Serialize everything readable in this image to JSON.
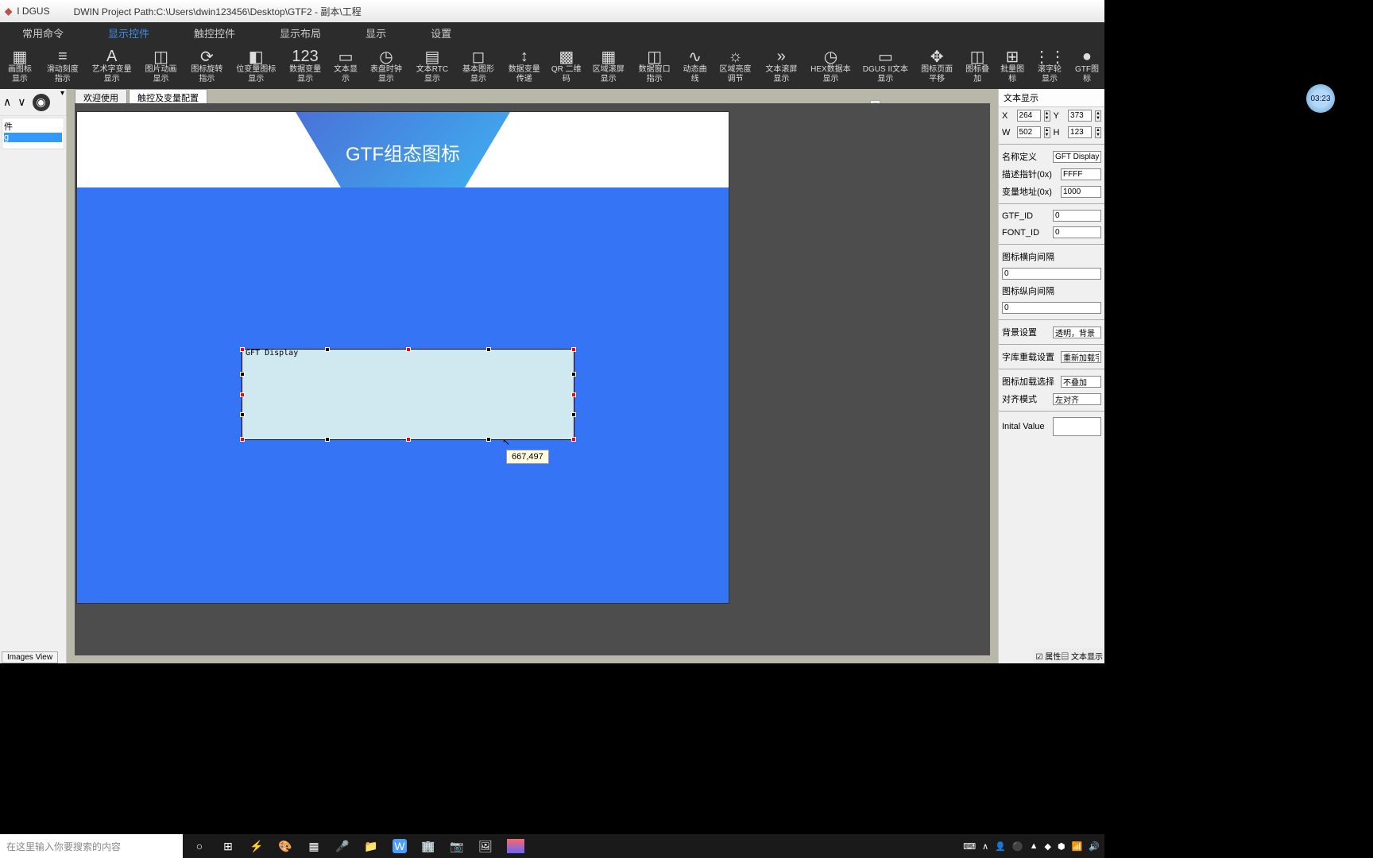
{
  "title_bar": {
    "app": "I DGUS",
    "path_label": "DWIN Project Path:C:\\Users\\dwin123456\\Desktop\\GTF2 - 副本\\工程"
  },
  "menu": {
    "items": [
      "常用命令",
      "显示控件",
      "触控控件",
      "显示布局",
      "显示",
      "设置"
    ],
    "active_index": 1
  },
  "toolbar": {
    "items": [
      "画图标显示",
      "滑动刻度指示",
      "艺术字变量显示",
      "图片动画显示",
      "图标旋转指示",
      "位变量图标显示",
      "数据变量显示",
      "文本显示",
      "表盘时钟显示",
      "文本RTC显示",
      "基本图形显示",
      "数据变量传递",
      "QR 二维码",
      "区域滚屏显示",
      "数据窗口指示",
      "动态曲线",
      "区域亮度调节",
      "文本滚屏显示",
      "HEX数据本显示",
      "DGUS II文本显示",
      "图标页面平移",
      "图标叠加",
      "批量图标",
      "滚字轮显示",
      "GTF图标"
    ]
  },
  "tabs": {
    "items": [
      "欢迎使用",
      "触控及变量配置"
    ],
    "active_index": 1
  },
  "canvas": {
    "header_text": "GTF组态图标",
    "selection_label": "GFT Display",
    "coord_tip": "667,497"
  },
  "right_panel": {
    "header": "文本显示",
    "x_label": "X",
    "x_value": "264",
    "y_label": "Y",
    "y_value": "373",
    "w_label": "W",
    "w_value": "502",
    "h_label": "H",
    "h_value": "123",
    "name_def_label": "名称定义",
    "name_def_value": "GFT Display",
    "desc_ptr_label": "描述指针(0x)",
    "desc_ptr_value": "FFFF",
    "var_addr_label": "变量地址(0x)",
    "var_addr_value": "1000",
    "gtf_id_label": "GTF_ID",
    "gtf_id_value": "0",
    "font_id_label": "FONT_ID",
    "font_id_value": "0",
    "icon_hgap_label": "图标横向间隔",
    "icon_hgap_value": "0",
    "icon_vgap_label": "图标纵向间隔",
    "icon_vgap_value": "0",
    "bg_label": "背景设置",
    "bg_value": "透明，背景",
    "font_reload_label": "字库重载设置",
    "font_reload_value": "重新加载字",
    "icon_load_label": "图标加载选择",
    "icon_load_value": "不叠加",
    "align_label": "对齐模式",
    "align_value": "左对齐",
    "init_val_label": "Inital Value",
    "init_val_value": ""
  },
  "bottom_tabs": {
    "attr": "属性",
    "text_disp": "文本显示"
  },
  "images_view": "Images View",
  "left_tree": {
    "item1": "件",
    "item2": "g"
  },
  "clock": "03:23",
  "taskbar": {
    "search_placeholder": "在这里输入你要搜索的内容"
  }
}
